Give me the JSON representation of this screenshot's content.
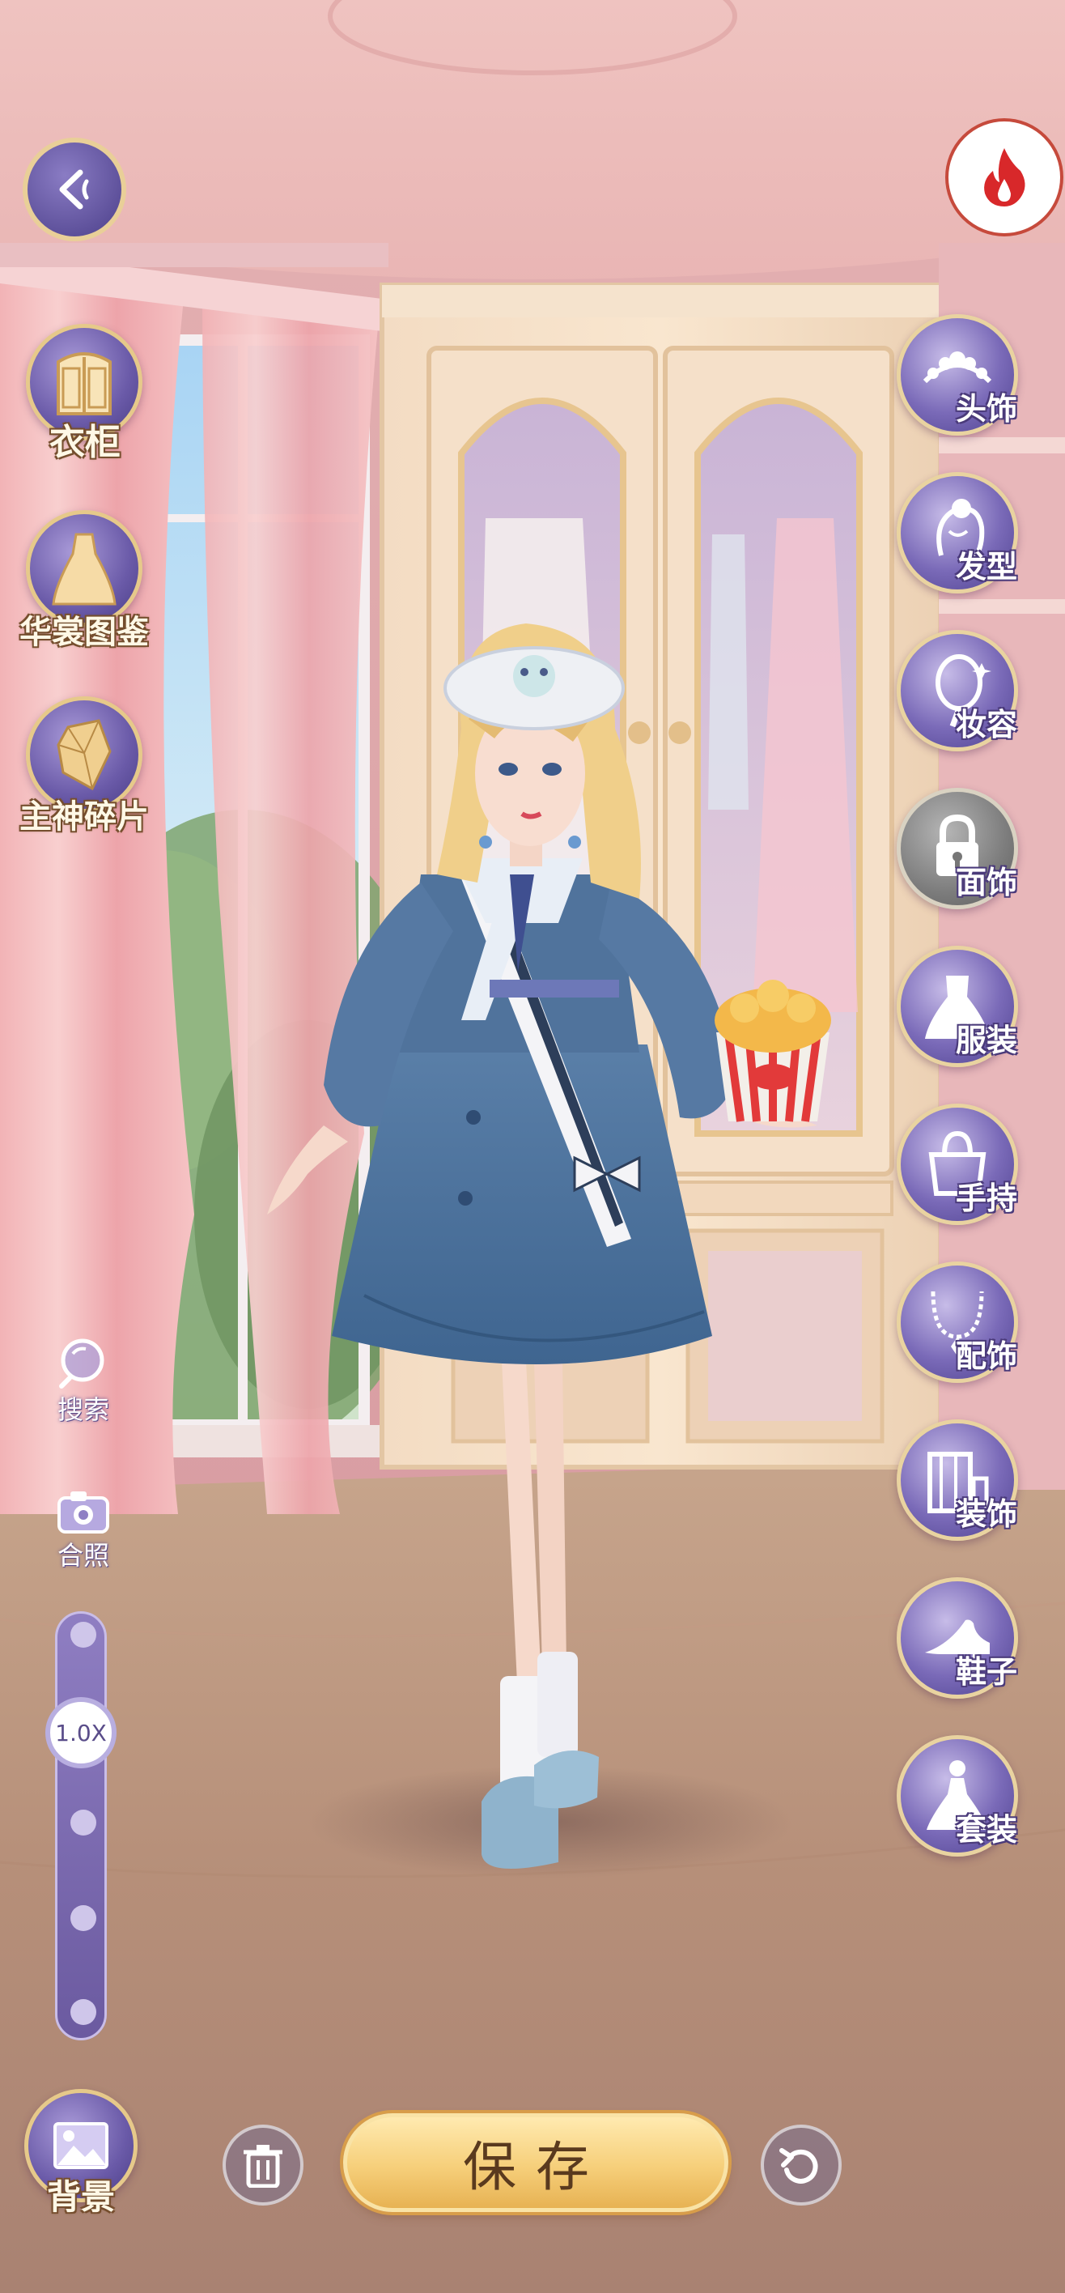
{
  "left_menu": {
    "wardrobe_label": "衣柜",
    "catalog_label": "华裳图鉴",
    "fragments_label": "主神碎片",
    "search_label": "搜索",
    "photo_label": "合照",
    "background_label": "背景"
  },
  "zoom": {
    "level_label": "1.0X",
    "level": 1.0
  },
  "categories": [
    {
      "label": "头饰",
      "icon": "headpiece-icon"
    },
    {
      "label": "发型",
      "icon": "hairstyle-icon"
    },
    {
      "label": "妆容",
      "icon": "makeup-mirror-icon"
    },
    {
      "label": "面饰",
      "icon": "lock-icon"
    },
    {
      "label": "服装",
      "icon": "dress-icon"
    },
    {
      "label": "手持",
      "icon": "handbag-icon"
    },
    {
      "label": "配饰",
      "icon": "necklace-icon"
    },
    {
      "label": "装饰",
      "icon": "decoration-icon"
    },
    {
      "label": "鞋子",
      "icon": "high-heel-icon"
    },
    {
      "label": "套装",
      "icon": "outfit-set-icon"
    }
  ],
  "bottom_bar": {
    "save_label": "保存"
  },
  "colors": {
    "accent_purple": "#6a5aa8",
    "gold": "#e6c98a",
    "flame_red": "#d8282a"
  }
}
